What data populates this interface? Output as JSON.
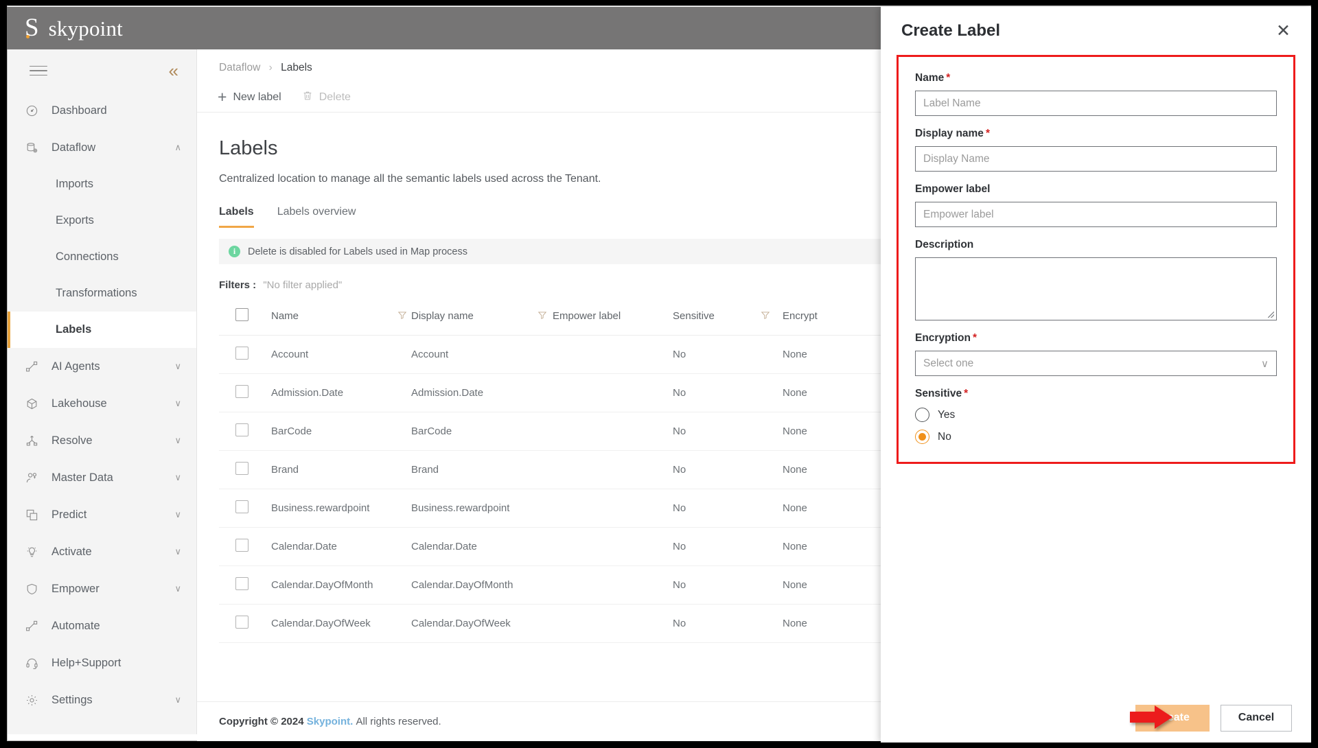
{
  "brand": {
    "mark": "S",
    "name": "skypoint"
  },
  "sidebar": {
    "collapse_icon": "chevron-double-left",
    "items": [
      {
        "label": "Dashboard",
        "icon": "gauge-icon",
        "chevron": ""
      },
      {
        "label": "Dataflow",
        "icon": "database-gear-icon",
        "chevron": "∧"
      },
      {
        "label": "AI Agents",
        "icon": "nodes-icon",
        "chevron": "∨"
      },
      {
        "label": "Lakehouse",
        "icon": "cube-icon",
        "chevron": "∨"
      },
      {
        "label": "Resolve",
        "icon": "merge-icon",
        "chevron": "∨"
      },
      {
        "label": "Master Data",
        "icon": "person-key-icon",
        "chevron": "∨"
      },
      {
        "label": "Predict",
        "icon": "copy-icon",
        "chevron": "∨"
      },
      {
        "label": "Activate",
        "icon": "lightbulb-icon",
        "chevron": "∨"
      },
      {
        "label": "Empower",
        "icon": "shield-icon",
        "chevron": "∨"
      },
      {
        "label": "Automate",
        "icon": "nodes-icon",
        "chevron": ""
      },
      {
        "label": "Help+Support",
        "icon": "headset-icon",
        "chevron": ""
      },
      {
        "label": "Settings",
        "icon": "gear-icon",
        "chevron": "∨"
      }
    ],
    "dataflow_children": [
      {
        "label": "Imports",
        "active": false
      },
      {
        "label": "Exports",
        "active": false
      },
      {
        "label": "Connections",
        "active": false
      },
      {
        "label": "Transformations",
        "active": false
      },
      {
        "label": "Labels",
        "active": true
      }
    ]
  },
  "breadcrumb": {
    "parent": "Dataflow",
    "separator": "›",
    "current": "Labels"
  },
  "commandbar": {
    "new_label": "New label",
    "delete": "Delete"
  },
  "page": {
    "title": "Labels",
    "subtitle": "Centralized location to manage all the semantic labels used across the Tenant."
  },
  "tabs": [
    {
      "label": "Labels",
      "active": true
    },
    {
      "label": "Labels overview",
      "active": false
    }
  ],
  "info_banner": {
    "icon_char": "i",
    "text": "Delete is disabled for Labels used in Map process"
  },
  "filters": {
    "label": "Filters :",
    "value": "\"No filter applied\""
  },
  "table": {
    "columns": [
      "Name",
      "Display name",
      "Empower label",
      "Sensitive",
      "Encrypt"
    ],
    "rows": [
      {
        "name": "Account",
        "display": "Account",
        "empower": "",
        "sensitive": "No",
        "encrypt": "None"
      },
      {
        "name": "Admission.Date",
        "display": "Admission.Date",
        "empower": "",
        "sensitive": "No",
        "encrypt": "None"
      },
      {
        "name": "BarCode",
        "display": "BarCode",
        "empower": "",
        "sensitive": "No",
        "encrypt": "None"
      },
      {
        "name": "Brand",
        "display": "Brand",
        "empower": "",
        "sensitive": "No",
        "encrypt": "None"
      },
      {
        "name": "Business.rewardpoint",
        "display": "Business.rewardpoint",
        "empower": "",
        "sensitive": "No",
        "encrypt": "None"
      },
      {
        "name": "Calendar.Date",
        "display": "Calendar.Date",
        "empower": "",
        "sensitive": "No",
        "encrypt": "None"
      },
      {
        "name": "Calendar.DayOfMonth",
        "display": "Calendar.DayOfMonth",
        "empower": "",
        "sensitive": "No",
        "encrypt": "None"
      },
      {
        "name": "Calendar.DayOfWeek",
        "display": "Calendar.DayOfWeek",
        "empower": "",
        "sensitive": "No",
        "encrypt": "None"
      }
    ]
  },
  "footer": {
    "copyright": "Copyright © 2024",
    "brand": "Skypoint.",
    "rights": "All rights reserved."
  },
  "panel": {
    "title": "Create Label",
    "close_icon": "close-icon",
    "fields": {
      "name": {
        "label": "Name",
        "required": "*",
        "placeholder": "Label Name",
        "value": ""
      },
      "display_name": {
        "label": "Display name",
        "required": "*",
        "placeholder": "Display Name",
        "value": ""
      },
      "empower_label": {
        "label": "Empower label",
        "required": "",
        "placeholder": "Empower label",
        "value": ""
      },
      "description": {
        "label": "Description",
        "required": "",
        "placeholder": "",
        "value": ""
      },
      "encryption": {
        "label": "Encryption",
        "required": "*",
        "placeholder": "Select one",
        "value": "",
        "chevron": "∨"
      },
      "sensitive": {
        "label": "Sensitive",
        "required": "*",
        "options": [
          {
            "label": "Yes",
            "selected": false
          },
          {
            "label": "No",
            "selected": true
          }
        ]
      }
    },
    "actions": {
      "create": "Create",
      "cancel": "Cancel"
    }
  },
  "colors": {
    "accent": "#e8a33d",
    "brandbar": "#767575",
    "highlight_box": "#ee1b1b",
    "arrow": "#ec1c1c",
    "create_button": "#f7c289",
    "radio_on": "#f0901a",
    "info_dot": "#6dd6a0",
    "footer_link": "#74b2dd"
  }
}
